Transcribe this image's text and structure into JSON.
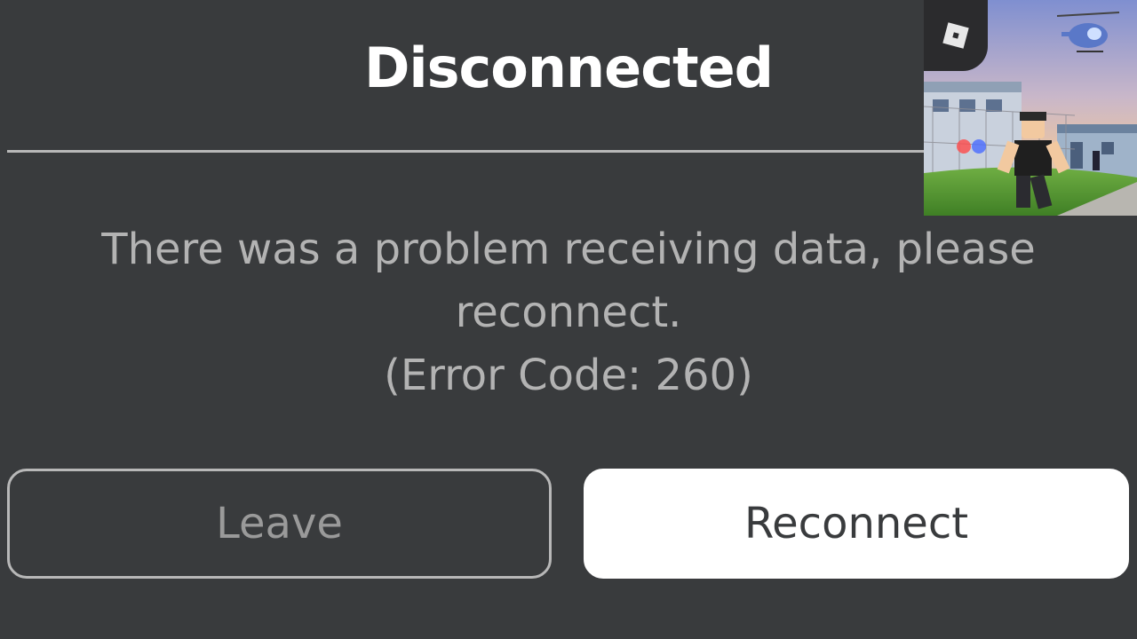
{
  "dialog": {
    "title": "Disconnected",
    "message_line1": "There was a problem receiving data, please",
    "message_line2": "reconnect.",
    "message_line3": "(Error Code: 260)",
    "leave_label": "Leave",
    "reconnect_label": "Reconnect"
  },
  "thumbnail": {
    "logo_icon": "roblox-logo-icon",
    "art": "game-scene-illustration"
  },
  "colors": {
    "background": "#393b3d",
    "title": "#ffffff",
    "message": "#b3b3b3",
    "leave_text": "#9a9a9a",
    "reconnect_bg": "#ffffff"
  }
}
